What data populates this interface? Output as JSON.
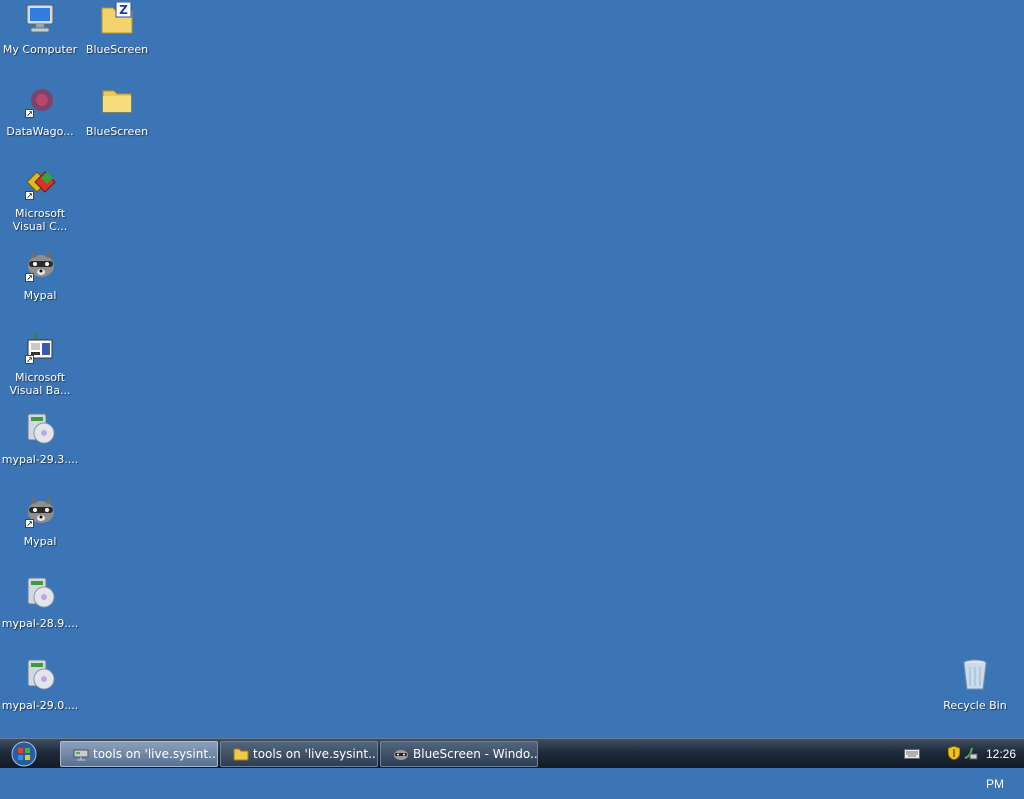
{
  "desktop": {
    "icons": [
      {
        "label": "My Computer",
        "icon": "computer-icon"
      },
      {
        "label": "BlueScreen",
        "icon": "zip-folder-icon"
      },
      {
        "label": "DataWago...",
        "icon": "datawagon-icon"
      },
      {
        "label": "BlueScreen",
        "icon": "folder-icon"
      },
      {
        "label": "Microsoft Visual C...",
        "icon": "visual-c-icon"
      },
      {
        "label": "Mypal",
        "icon": "raccoon-icon"
      },
      {
        "label": "Microsoft Visual Ba...",
        "icon": "visual-basic-icon"
      },
      {
        "label": "mypal-29.3....",
        "icon": "installer-icon"
      },
      {
        "label": "Mypal",
        "icon": "raccoon-icon"
      },
      {
        "label": "mypal-28.9....",
        "icon": "installer-icon"
      },
      {
        "label": "mypal-29.0....",
        "icon": "installer-icon"
      },
      {
        "label": "Recycle Bin",
        "icon": "recycle-bin-icon"
      }
    ]
  },
  "taskbar": {
    "start_icon": "windows-orb-icon",
    "buttons": [
      {
        "label": "tools on 'live.sysint...",
        "icon": "network-drive-icon"
      },
      {
        "label": "tools on 'live.sysint...",
        "icon": "folder-icon"
      },
      {
        "label": "BlueScreen - Windo...",
        "icon": "raccoon-icon"
      }
    ],
    "tray": {
      "clock": "12:26 PM",
      "icons": [
        "keyboard-icon",
        "security-shield-icon",
        "network-icon"
      ]
    }
  },
  "colors": {
    "desktop_background": "#3b75b5",
    "taskbar": "#1f2b3b"
  }
}
